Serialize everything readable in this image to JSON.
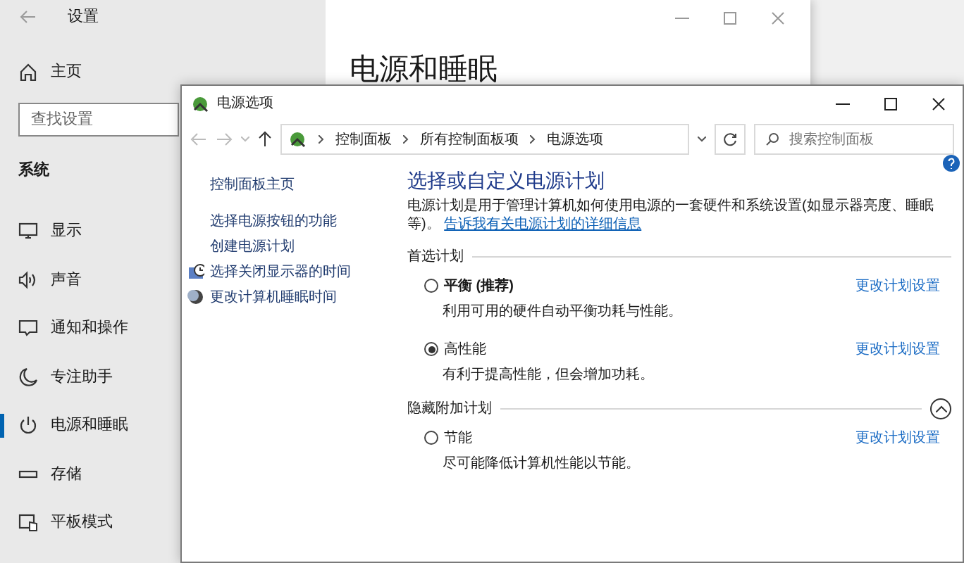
{
  "settings_window": {
    "title": "设置",
    "home": "主页",
    "search": {
      "placeholder": "查找设置"
    },
    "section": "系统",
    "page_title": "电源和睡眠",
    "nav_items": [
      {
        "label": "显示",
        "selected": false
      },
      {
        "label": "声音",
        "selected": false
      },
      {
        "label": "通知和操作",
        "selected": false
      },
      {
        "label": "专注助手",
        "selected": false
      },
      {
        "label": "电源和睡眠",
        "selected": true
      },
      {
        "label": "存储",
        "selected": false
      },
      {
        "label": "平板模式",
        "selected": false
      }
    ]
  },
  "control_panel": {
    "title": "电源选项",
    "breadcrumb": [
      "控制面板",
      "所有控制面板项",
      "电源选项"
    ],
    "search": {
      "placeholder": "搜索控制面板"
    },
    "side_links": [
      {
        "label": "控制面板主页"
      },
      {
        "label": "选择电源按钮的功能"
      },
      {
        "label": "创建电源计划"
      },
      {
        "label": "选择关闭显示器的时间"
      },
      {
        "label": "更改计算机睡眠时间"
      }
    ],
    "heading": "选择或自定义电源计划",
    "description": "电源计划是用于管理计算机如何使用电源的一套硬件和系统设置(如显示器亮度、睡眠等)。",
    "description_link": "告诉我有关电源计划的详细信息",
    "groups": [
      {
        "title": "首选计划",
        "plans": [
          {
            "name": "平衡 (推荐)",
            "recommended": true,
            "selected": false,
            "description": "利用可用的硬件自动平衡功耗与性能。",
            "action": "更改计划设置"
          },
          {
            "name": "高性能",
            "recommended": false,
            "selected": true,
            "description": "有利于提高性能，但会增加功耗。",
            "action": "更改计划设置"
          }
        ]
      },
      {
        "title": "隐藏附加计划",
        "expanded": true,
        "plans": [
          {
            "name": "节能",
            "recommended": false,
            "selected": false,
            "description": "尽可能降低计算机性能以节能。",
            "action": "更改计划设置"
          }
        ]
      }
    ]
  }
}
